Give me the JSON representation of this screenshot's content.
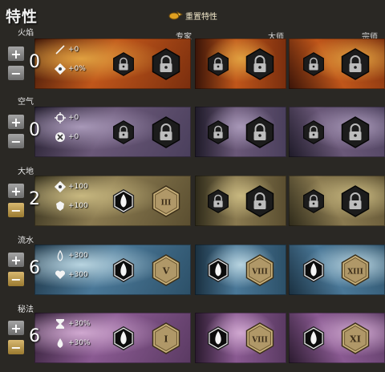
{
  "title": "特性",
  "reset_label": "重置特性",
  "tiers": [
    "专家",
    "大师",
    "宗师"
  ],
  "lines": [
    {
      "name": "火焰",
      "points": "0",
      "stats": [
        {
          "icon": "wand-icon",
          "text": "+0"
        },
        {
          "icon": "crit-damage-icon",
          "text": "+0%"
        }
      ],
      "minor": [
        {
          "state": "locked"
        },
        {
          "state": "locked"
        },
        {
          "state": "locked"
        }
      ],
      "major": [
        {
          "state": "locked"
        },
        {
          "state": "locked"
        },
        {
          "state": "locked"
        }
      ]
    },
    {
      "name": "空气",
      "points": "0",
      "stats": [
        {
          "icon": "precision-icon",
          "text": "+0"
        },
        {
          "icon": "crit-icon",
          "text": "+0"
        }
      ],
      "minor": [
        {
          "state": "locked"
        },
        {
          "state": "locked"
        },
        {
          "state": "locked"
        }
      ],
      "major": [
        {
          "state": "locked"
        },
        {
          "state": "locked"
        },
        {
          "state": "locked"
        }
      ]
    },
    {
      "name": "大地",
      "points": "2",
      "stats": [
        {
          "icon": "toughness-icon",
          "text": "+100"
        },
        {
          "icon": "vitality-icon",
          "text": "+100"
        }
      ],
      "minor": [
        {
          "state": "unlocked"
        },
        {
          "state": "locked"
        },
        {
          "state": "locked"
        }
      ],
      "major": [
        {
          "state": "numeral",
          "label": "III"
        },
        {
          "state": "locked"
        },
        {
          "state": "locked"
        }
      ]
    },
    {
      "name": "流水",
      "points": "6",
      "stats": [
        {
          "icon": "healing-icon",
          "text": "+300"
        },
        {
          "icon": "heart-icon",
          "text": "+300"
        }
      ],
      "minor": [
        {
          "state": "unlocked"
        },
        {
          "state": "unlocked"
        },
        {
          "state": "unlocked"
        }
      ],
      "major": [
        {
          "state": "numeral",
          "label": "V"
        },
        {
          "state": "numeral",
          "label": "VIII"
        },
        {
          "state": "numeral",
          "label": "XIII"
        }
      ]
    },
    {
      "name": "秘法",
      "points": "6",
      "stats": [
        {
          "icon": "hourglass-icon",
          "text": "+30%"
        },
        {
          "icon": "boon-duration-icon",
          "text": "+30%"
        }
      ],
      "minor": [
        {
          "state": "unlocked"
        },
        {
          "state": "unlocked"
        },
        {
          "state": "unlocked"
        }
      ],
      "major": [
        {
          "state": "numeral",
          "label": "I"
        },
        {
          "state": "numeral",
          "label": "VIII"
        },
        {
          "state": "numeral",
          "label": "XI"
        }
      ]
    }
  ],
  "backgrounds": [
    [
      "#3a1408",
      "#c0561a",
      "#e0a040",
      "#7a2e0e"
    ],
    [
      "#1e1a28",
      "#6a5878",
      "#a898b8",
      "#4a3f5c"
    ],
    [
      "#2e2a1a",
      "#8a7a50",
      "#c8b880",
      "#5a4e30"
    ],
    [
      "#1a3040",
      "#4a7898",
      "#b8d4e0",
      "#2c5068"
    ],
    [
      "#2a1a2e",
      "#8a5a92",
      "#d0a8d0",
      "#5a3a62"
    ]
  ]
}
